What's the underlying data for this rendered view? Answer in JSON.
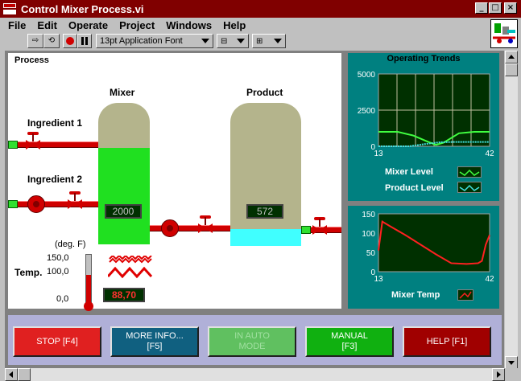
{
  "window": {
    "title": "Control Mixer Process.vi",
    "minimize": "_",
    "maximize": "□",
    "close": "×"
  },
  "menu": [
    "File",
    "Edit",
    "Operate",
    "Project",
    "Windows",
    "Help"
  ],
  "toolbar": {
    "font_select": "13pt Application Font"
  },
  "process": {
    "title": "Process",
    "mixer_label": "Mixer",
    "product_label": "Product",
    "ingredient1_label": "Ingredient 1",
    "ingredient2_label": "Ingredient 2",
    "mixer_value": "2000",
    "product_value": "572",
    "mixer_level_fraction": 0.68,
    "product_level_fraction": 0.12,
    "temp_unit": "(deg. F)",
    "temp_label": "Temp.",
    "temp_ticks": [
      "150,0",
      "100,0",
      "0,0"
    ],
    "temp_value": "88,70",
    "temp_fraction": 0.59
  },
  "trends": {
    "title": "Operating Trends",
    "legend": {
      "mixer_level": "Mixer Level",
      "product_level": "Product Level",
      "mixer_temp": "Mixer Temp"
    },
    "colors": {
      "mixer_level": "#40ff40",
      "product_level": "#40e0e0",
      "mixer_temp": "#ff2020",
      "panel": "#008080"
    }
  },
  "chart_data": [
    {
      "type": "line",
      "ylim": [
        0,
        5000
      ],
      "yticks": [
        "5000",
        "2500",
        "0"
      ],
      "xlim": [
        13,
        42
      ],
      "xticks": [
        "13",
        "42"
      ],
      "grid": true,
      "series": [
        {
          "name": "Mixer Level",
          "x": [
            13,
            18,
            22,
            26,
            28,
            30,
            34,
            38,
            40,
            42
          ],
          "values": [
            1000,
            1000,
            750,
            300,
            100,
            250,
            900,
            1000,
            1000,
            1000
          ]
        },
        {
          "name": "Product Level",
          "x": [
            13,
            17,
            21,
            25,
            29,
            33,
            37,
            42
          ],
          "values": [
            0,
            0,
            0,
            150,
            280,
            300,
            300,
            300
          ]
        }
      ]
    },
    {
      "type": "line",
      "ylim": [
        0,
        150
      ],
      "yticks": [
        "150",
        "100",
        "50",
        "0"
      ],
      "xlim": [
        13,
        42
      ],
      "xticks": [
        "13",
        "42"
      ],
      "grid": false,
      "series": [
        {
          "name": "Mixer Temp",
          "x": [
            13,
            14,
            16,
            20,
            24,
            28,
            32,
            36,
            39,
            40,
            41,
            42
          ],
          "values": [
            55,
            130,
            118,
            95,
            70,
            45,
            22,
            20,
            22,
            28,
            70,
            95
          ]
        }
      ]
    }
  ],
  "buttons": [
    {
      "label": "STOP [F4]",
      "color": "#e02020"
    },
    {
      "label": "MORE INFO...\n[F5]",
      "color": "#106080"
    },
    {
      "label": "IN AUTO\nMODE",
      "color": "#60c060"
    },
    {
      "label": "MANUAL\n[F3]",
      "color": "#10b010"
    },
    {
      "label": "HELP [F1]",
      "color": "#a00000"
    }
  ]
}
